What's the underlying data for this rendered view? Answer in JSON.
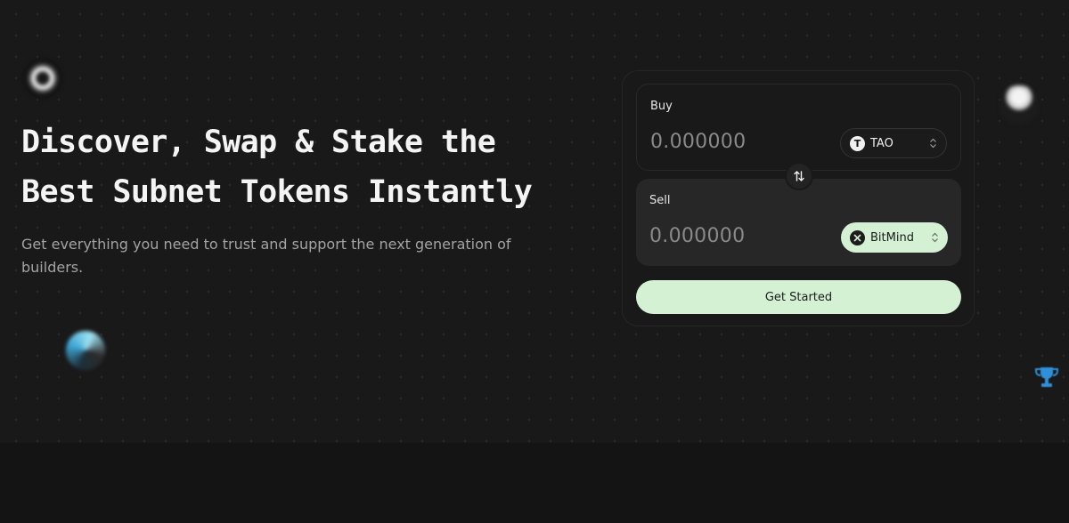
{
  "hero": {
    "headline_line1": "Discover, Swap & Stake the",
    "headline_line2": "Best Subnet Tokens Instantly",
    "subtitle": "Get everything you need to trust and support the next generation of builders."
  },
  "swap": {
    "buy_label": "Buy",
    "buy_amount": "0.000000",
    "buy_token": "TAO",
    "buy_token_icon_letter": "T",
    "sell_label": "Sell",
    "sell_amount": "0.000000",
    "sell_token": "BitMind",
    "cta_label": "Get Started"
  },
  "icons": {
    "floating": [
      "subnet-logo-icon",
      "subnet-logo-icon",
      "subnet-logo-icon",
      "trophy-icon"
    ],
    "swap": "swap-arrows-icon",
    "chevron": "chevron-up-down-icon"
  },
  "colors": {
    "accent": "#d4f1d4",
    "background": "#191919",
    "trophy": "#2f8fd8"
  }
}
